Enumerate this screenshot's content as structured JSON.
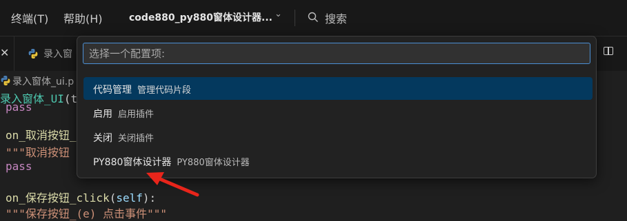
{
  "menubar": {
    "items": [
      "终端(T)",
      "帮助(H)"
    ],
    "project": "code880_py880窗体设计器...",
    "search_label": "搜索"
  },
  "tabs": [
    {
      "label": "录入窗"
    }
  ],
  "breadcrumb": {
    "file": "录入窗体_ui.p"
  },
  "editor": {
    "lines": {
      "l1_cls": "录入窗体_UI",
      "l1_rest": "(t",
      "l2": "pass",
      "l3_fn": "on_取消按钮_",
      "l4": "\"\"\"取消按钮",
      "l5": "pass",
      "l6_fn": "on_保存按钮_click",
      "l6_paren": "(",
      "l6_self": "self",
      "l6_tail": "):",
      "l7": "\"\"\"保存按钮_(e) 点击事件\"\"\""
    }
  },
  "quickpick": {
    "placeholder": "选择一个配置项:",
    "items": [
      {
        "label": "代码管理",
        "description": "管理代码片段",
        "active": true
      },
      {
        "label": "启用",
        "description": "启用插件",
        "active": false
      },
      {
        "label": "关闭",
        "description": "关闭插件",
        "active": false
      },
      {
        "label": "PY880窗体设计器",
        "description": "PY880窗体设计器",
        "active": false
      }
    ]
  },
  "colors": {
    "accent": "#4b90d6",
    "selection": "#04395e",
    "annotation_arrow": "#e8251b"
  },
  "icons": [
    "chevron-down-icon",
    "search-icon",
    "close-icon",
    "python-file-icon",
    "split-editor-icon"
  ]
}
